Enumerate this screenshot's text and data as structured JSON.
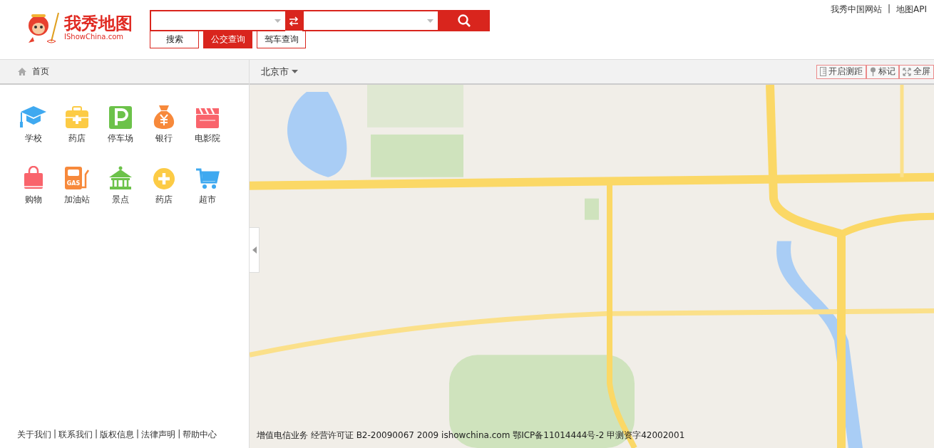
{
  "logo": {
    "name": "我秀地图",
    "domain": "IShowChina.com"
  },
  "search": {
    "tabs": [
      {
        "label": "搜索",
        "selected": false
      },
      {
        "label": "公交查询",
        "selected": true
      },
      {
        "label": "驾车查询",
        "selected": false
      }
    ]
  },
  "top_links": {
    "items": [
      "我秀中国网站",
      "地图API"
    ],
    "separator": "|"
  },
  "sidebar": {
    "home": "首页",
    "categories": [
      {
        "label": "学校",
        "kind": "school"
      },
      {
        "label": "药店",
        "kind": "medkit"
      },
      {
        "label": "停车场",
        "kind": "parking"
      },
      {
        "label": "银行",
        "kind": "bank"
      },
      {
        "label": "电影院",
        "kind": "cinema"
      },
      {
        "label": "购物",
        "kind": "shopping"
      },
      {
        "label": "加油站",
        "kind": "gas",
        "icon_text": "GAS"
      },
      {
        "label": "景点",
        "kind": "scenic"
      },
      {
        "label": "药店",
        "kind": "pharmacy"
      },
      {
        "label": "超市",
        "kind": "cart"
      }
    ],
    "footer_links": [
      "关于我们",
      "联系我们",
      "版权信息",
      "法律声明",
      "帮助中心"
    ],
    "footer_separator": "|"
  },
  "map": {
    "city": "北京市",
    "tools": [
      {
        "label": "开启测距",
        "kind": "ruler"
      },
      {
        "label": "标记",
        "kind": "pin"
      },
      {
        "label": "全屏",
        "kind": "fullscreen"
      }
    ],
    "copyright": "增值电信业务 经营许可证 B2-20090067 2009 ishowchina.com 鄂ICP备11014444号-2 甲测资字42002001"
  }
}
